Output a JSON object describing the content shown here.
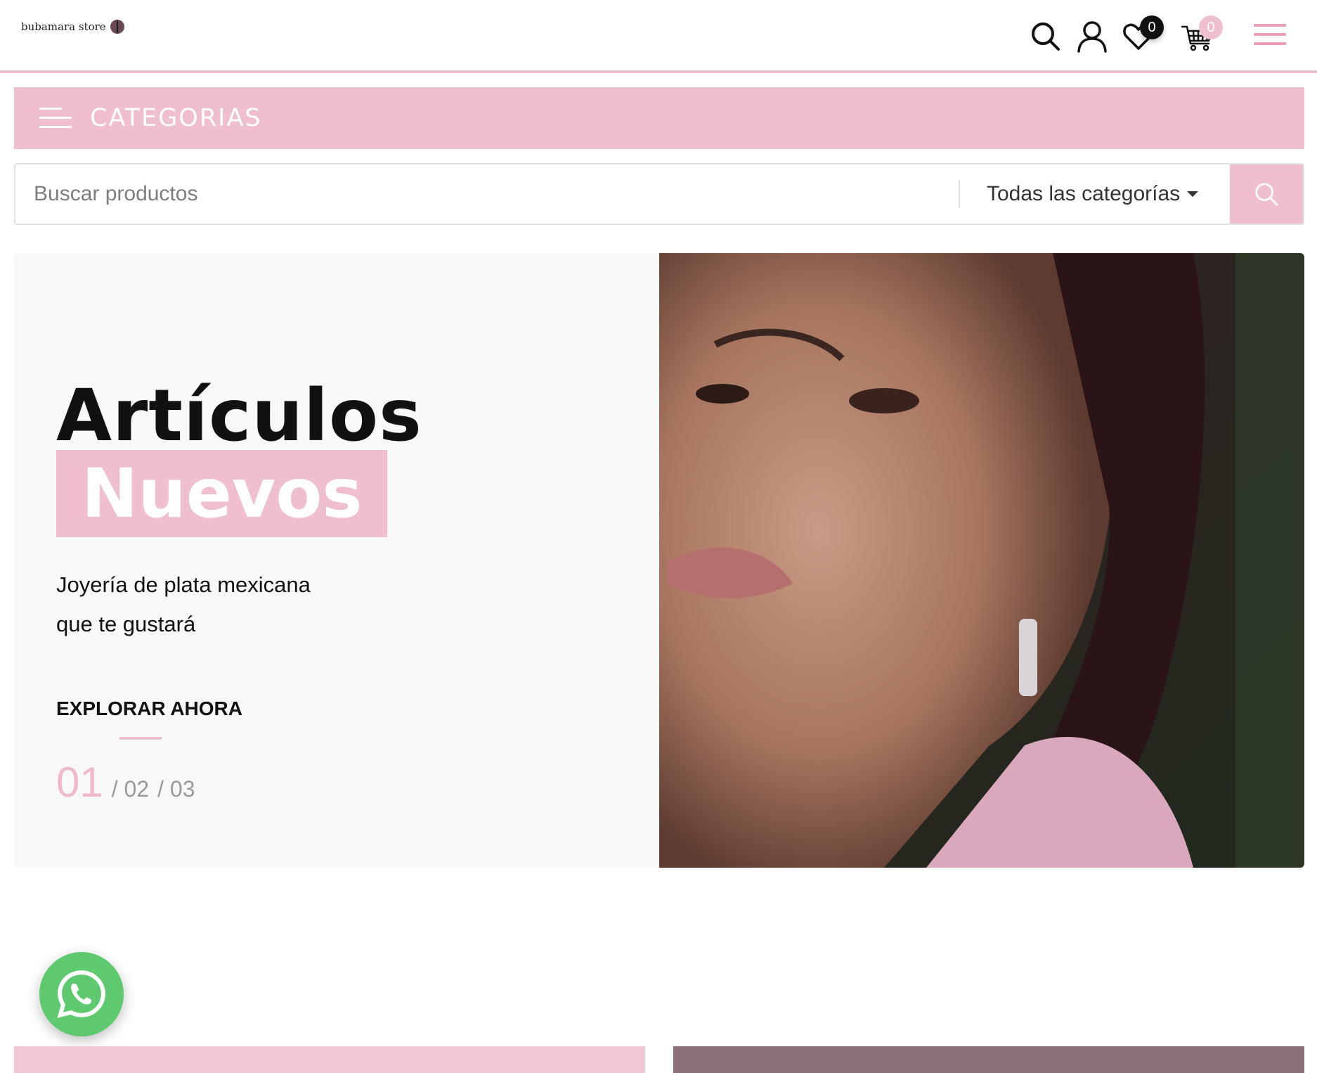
{
  "header": {
    "logo_text": "bubamara store",
    "wishlist_count": "0",
    "cart_count": "0"
  },
  "categories_bar": {
    "label": "CATEGORIAS"
  },
  "search": {
    "placeholder": "Buscar productos",
    "category_selected": "Todas las categorías"
  },
  "hero": {
    "title_line1": "Artículos",
    "title_line2": "Nuevos",
    "subtitle": "Joyería de plata mexicana que te gustará",
    "cta": "EXPLORAR AHORA",
    "pager": {
      "current": "01",
      "others": [
        "/ 02",
        "/ 03"
      ]
    }
  },
  "colors": {
    "brand_pink": "#efbfcf",
    "whatsapp_green": "#5ec96f"
  },
  "icons": [
    "search-icon",
    "user-icon",
    "heart-icon",
    "cart-icon",
    "menu-icon",
    "whatsapp-icon"
  ]
}
